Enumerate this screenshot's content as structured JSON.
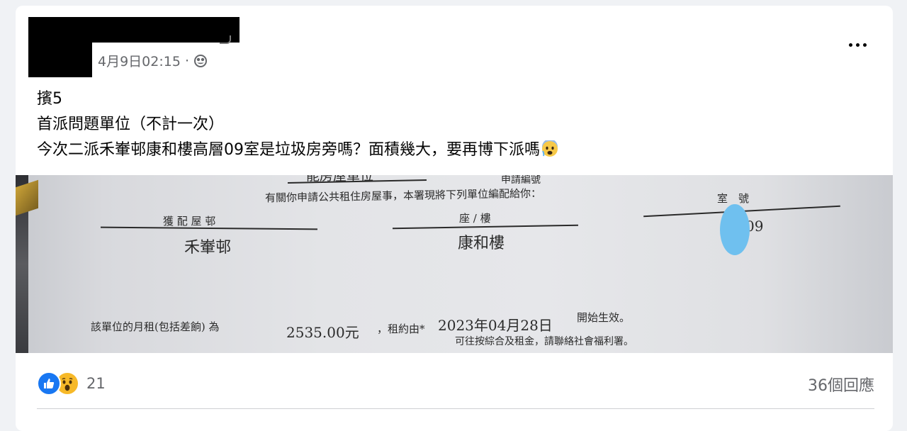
{
  "post": {
    "timestamp": "4月9日02:15",
    "separator": "·",
    "text_lines": [
      "擯5",
      "首派問題單位（不計一次）",
      "今次二派禾輋邨康和樓高層09室是垃圾房旁嗎？面積幾大，要再博下派嗎"
    ]
  },
  "photo": {
    "header_fragment": "能房屋單位",
    "app_no_label": "申請編號",
    "intro": "有關你申請公共租住房屋事，本署現將下列單位編配給你：",
    "estate_label": "獲 配 屋 邨",
    "estate_value": "禾輋邨",
    "block_label": "座 / 樓",
    "block_value": "康和樓",
    "room_label": "室　號",
    "room_value": "09",
    "rent_label": "該單位的月租(包括差餉) 為",
    "rent_value": "2535.00元",
    "lease_from": "，租約由*",
    "lease_date": "2023年04月28日",
    "lease_effective": "開始生效。",
    "bottom_fragment": "可往按綜合及租金，請聯絡社會福利署。"
  },
  "footer": {
    "reaction_count": "21",
    "comments_label": "36個回應"
  },
  "icons": [
    "globe-icon",
    "more-options-icon",
    "like-reaction-icon",
    "wow-reaction-icon",
    "fearful-emoji-icon"
  ]
}
